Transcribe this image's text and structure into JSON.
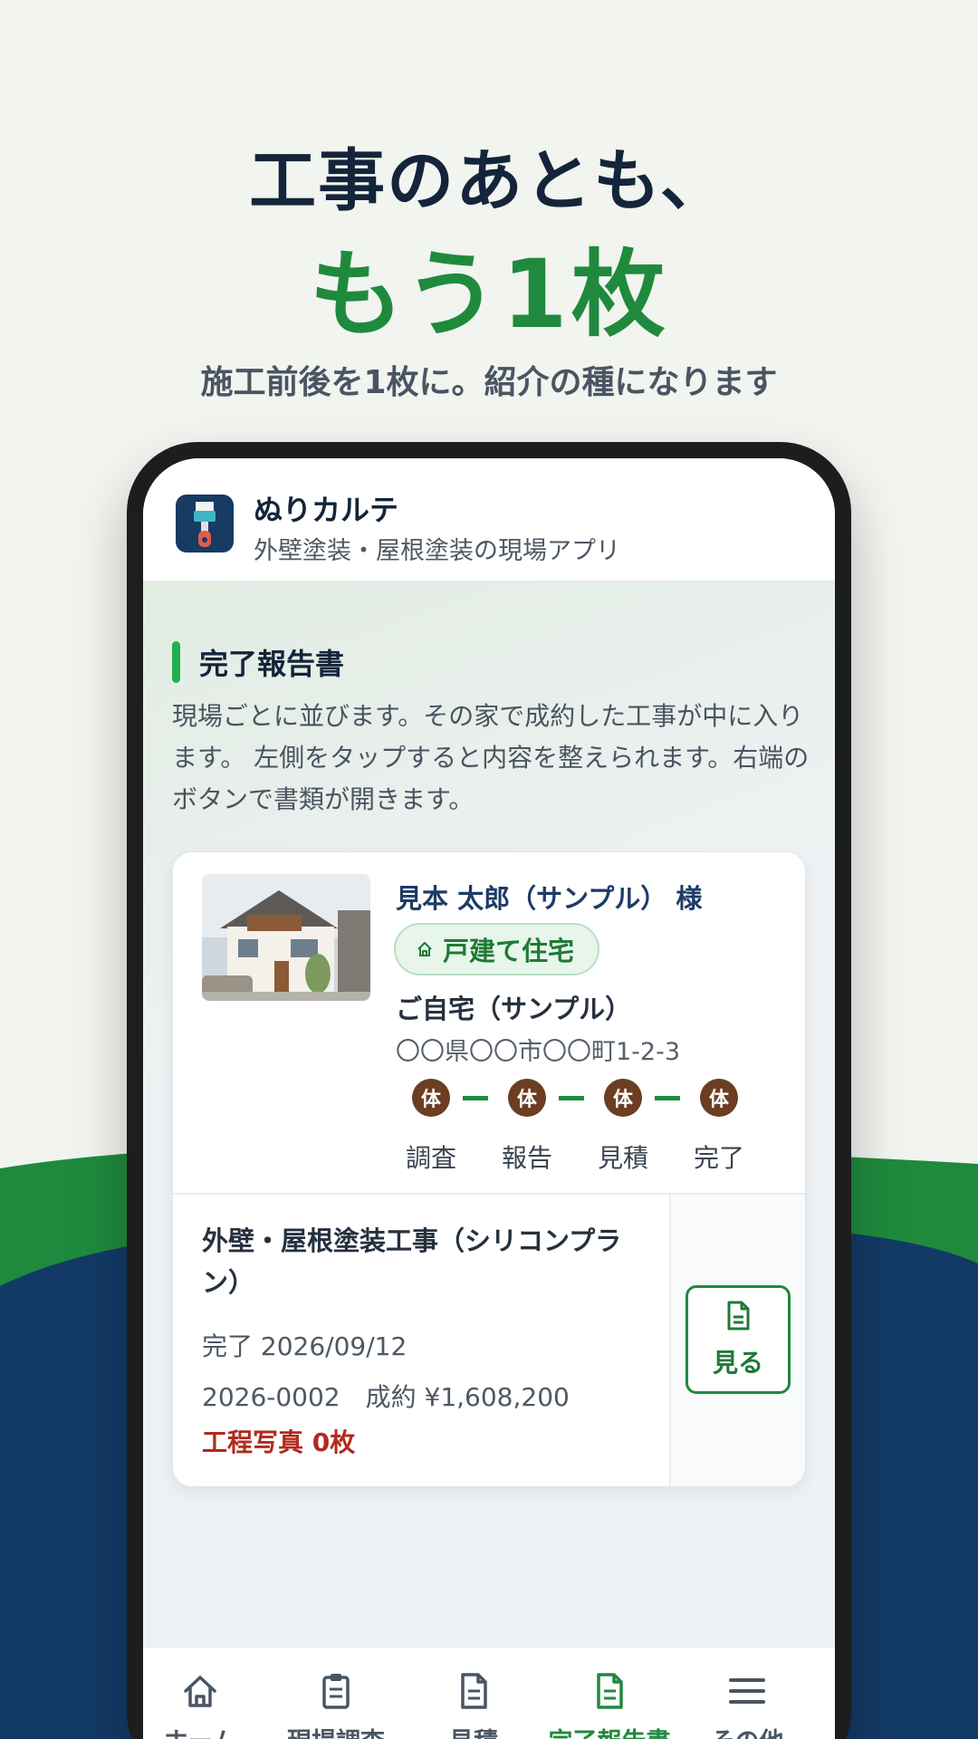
{
  "hero": {
    "line1": "工事のあとも、",
    "line2": "もう1枚",
    "subtitle": "施工前後を1枚に。紹介の種になります"
  },
  "app": {
    "name": "ぬりカルテ",
    "tagline": "外壁塗装・屋根塗装の現場アプリ",
    "icon": "paint-brush-icon"
  },
  "section": {
    "title": "完了報告書",
    "description": "現場ごとに並びます。その家で成約した工事が中に入ります。 左側をタップすると内容を整えられます。右端のボタンで書類が開きます。"
  },
  "card": {
    "customer_name": "見本 太郎（サンプル） 様",
    "building_type": "戸建て住宅",
    "site_name": "ご自宅（サンプル）",
    "address": "〇〇県〇〇市〇〇町1-2-3",
    "steps": [
      {
        "badge": "体",
        "label": "調査"
      },
      {
        "badge": "体",
        "label": "報告"
      },
      {
        "badge": "体",
        "label": "見積"
      },
      {
        "badge": "体",
        "label": "完了"
      }
    ],
    "job": {
      "title": "外壁・屋根塗装工事（シリコンプラン）",
      "completed": "完了 2026/09/12",
      "meta": "2026-0002　成約 ¥1,608,200",
      "photos": "工程写真 0枚",
      "view_label": "見る"
    }
  },
  "tabs": [
    {
      "label": "ホーム",
      "icon": "home-icon",
      "active": false
    },
    {
      "label": "現場調査",
      "icon": "clipboard-icon",
      "active": false
    },
    {
      "label": "見積",
      "icon": "document-icon",
      "active": false
    },
    {
      "label": "完了報告書",
      "icon": "report-icon",
      "active": true
    },
    {
      "label": "その他",
      "icon": "menu-icon",
      "active": false
    }
  ],
  "colors": {
    "brand_green": "#1f8a3d",
    "navy": "#133a66",
    "alert_red": "#b22a1f"
  }
}
